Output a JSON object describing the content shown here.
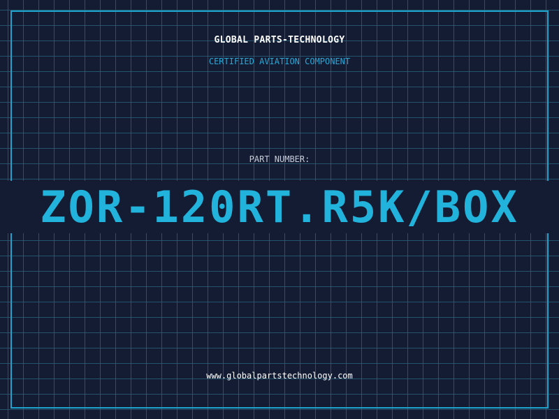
{
  "header": {
    "company": "GLOBAL PARTS-TECHNOLOGY",
    "tagline": "CERTIFIED AVIATION COMPONENT"
  },
  "part": {
    "label": "PART NUMBER:",
    "number": "ZOR-120RT.R5K/BOX"
  },
  "footer": {
    "url": "www.globalpartstechnology.com"
  },
  "colors": {
    "background": "#131c33",
    "grid": "#2a6680",
    "frame": "#1ea4cc",
    "accent": "#22b3dc"
  }
}
